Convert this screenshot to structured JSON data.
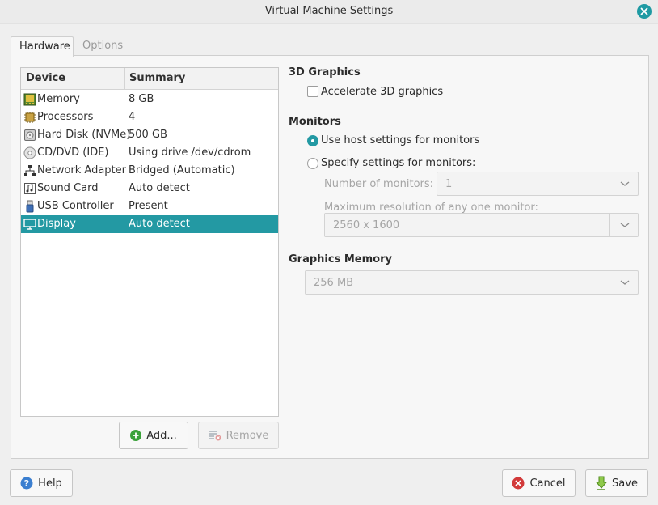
{
  "window": {
    "title": "Virtual Machine Settings"
  },
  "tabs": [
    {
      "label": "Hardware",
      "active": true
    },
    {
      "label": "Options",
      "active": false
    }
  ],
  "device_list": {
    "columns": [
      "Device",
      "Summary"
    ],
    "rows": [
      {
        "icon": "memory-icon",
        "device": "Memory",
        "summary": "8 GB",
        "selected": false
      },
      {
        "icon": "processor-icon",
        "device": "Processors",
        "summary": "4",
        "selected": false
      },
      {
        "icon": "hard-disk-icon",
        "device": "Hard Disk (NVMe)",
        "summary": "500 GB",
        "selected": false
      },
      {
        "icon": "cd-dvd-icon",
        "device": "CD/DVD (IDE)",
        "summary": "Using drive /dev/cdrom",
        "selected": false
      },
      {
        "icon": "network-adapter-icon",
        "device": "Network Adapter",
        "summary": "Bridged (Automatic)",
        "selected": false
      },
      {
        "icon": "sound-card-icon",
        "device": "Sound Card",
        "summary": "Auto detect",
        "selected": false
      },
      {
        "icon": "usb-controller-icon",
        "device": "USB Controller",
        "summary": "Present",
        "selected": false
      },
      {
        "icon": "display-icon",
        "device": "Display",
        "summary": "Auto detect",
        "selected": true
      }
    ]
  },
  "list_buttons": {
    "add": "Add...",
    "remove": "Remove"
  },
  "graphics3d": {
    "title": "3D Graphics",
    "accelerate_label": "Accelerate 3D graphics",
    "accelerate_checked": false
  },
  "monitors": {
    "title": "Monitors",
    "use_host_label": "Use host settings for monitors",
    "specify_label": "Specify settings for monitors:",
    "selected_option": "use_host",
    "number_label": "Number of monitors:",
    "number_value": "1",
    "max_res_label": "Maximum resolution of any one monitor:",
    "max_res_value": "2560 x 1600"
  },
  "graphics_memory": {
    "title": "Graphics Memory",
    "value": "256 MB"
  },
  "footer": {
    "help": "Help",
    "cancel": "Cancel",
    "save": "Save"
  },
  "colors": {
    "accent": "#2399a3",
    "close": "#1e9aa3",
    "add_icon": "#3aa23a",
    "cancel_icon": "#d23a3a"
  }
}
